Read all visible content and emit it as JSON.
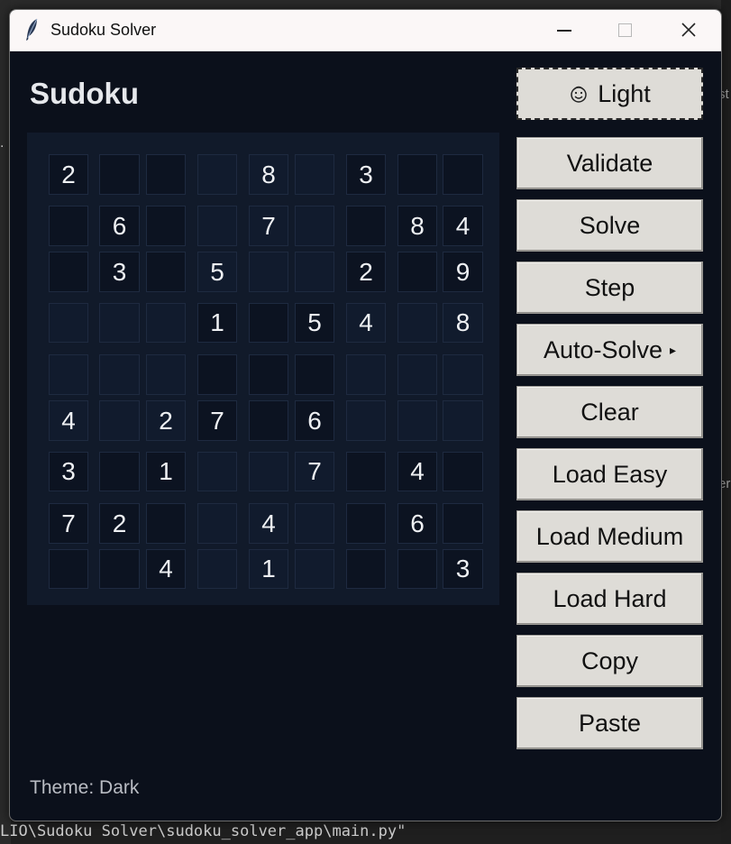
{
  "window": {
    "title": "Sudoku Solver",
    "icon": "feather-icon",
    "controls": [
      "minimize-icon",
      "maximize-icon",
      "close-icon"
    ]
  },
  "heading": "Sudoku",
  "grid": [
    [
      "2",
      "",
      "",
      "",
      "8",
      "",
      "3",
      "",
      ""
    ],
    [
      "",
      "6",
      "",
      "",
      "7",
      "",
      "",
      "8",
      "4"
    ],
    [
      "",
      "3",
      "",
      "5",
      "",
      "",
      "2",
      "",
      "9"
    ],
    [
      "",
      "",
      "",
      "1",
      "",
      "5",
      "4",
      "",
      "8"
    ],
    [
      "",
      "",
      "",
      "",
      "",
      "",
      "",
      "",
      ""
    ],
    [
      "4",
      "",
      "2",
      "7",
      "",
      "6",
      "",
      "",
      ""
    ],
    [
      "3",
      "",
      "1",
      "",
      "",
      "7",
      "",
      "4",
      ""
    ],
    [
      "7",
      "2",
      "",
      "",
      "4",
      "",
      "",
      "6",
      ""
    ],
    [
      "",
      "",
      "4",
      "",
      "1",
      "",
      "",
      "",
      "3"
    ]
  ],
  "buttons": {
    "theme": "Light",
    "validate": "Validate",
    "solve": "Solve",
    "step": "Step",
    "auto_solve": "Auto-Solve",
    "auto_solve_arrow": "▸",
    "clear": "Clear",
    "load_easy": "Load Easy",
    "load_medium": "Load Medium",
    "load_hard": "Load Hard",
    "copy": "Copy",
    "paste": "Paste"
  },
  "status": "Theme: Dark",
  "background": {
    "terminal_path": "LIO\\Sudoku Solver\\sudoku_solver_app\\main.py\"",
    "right_text_1": "st",
    "right_text_2": "er",
    "left_text": "."
  },
  "colors": {
    "window_bg": "#0b101b",
    "board_bg": "#111a2a",
    "cell_dark": "#0c1321",
    "cell_light": "#111b2d",
    "digit": "#eef0f3",
    "button_bg": "#dedcd7"
  }
}
